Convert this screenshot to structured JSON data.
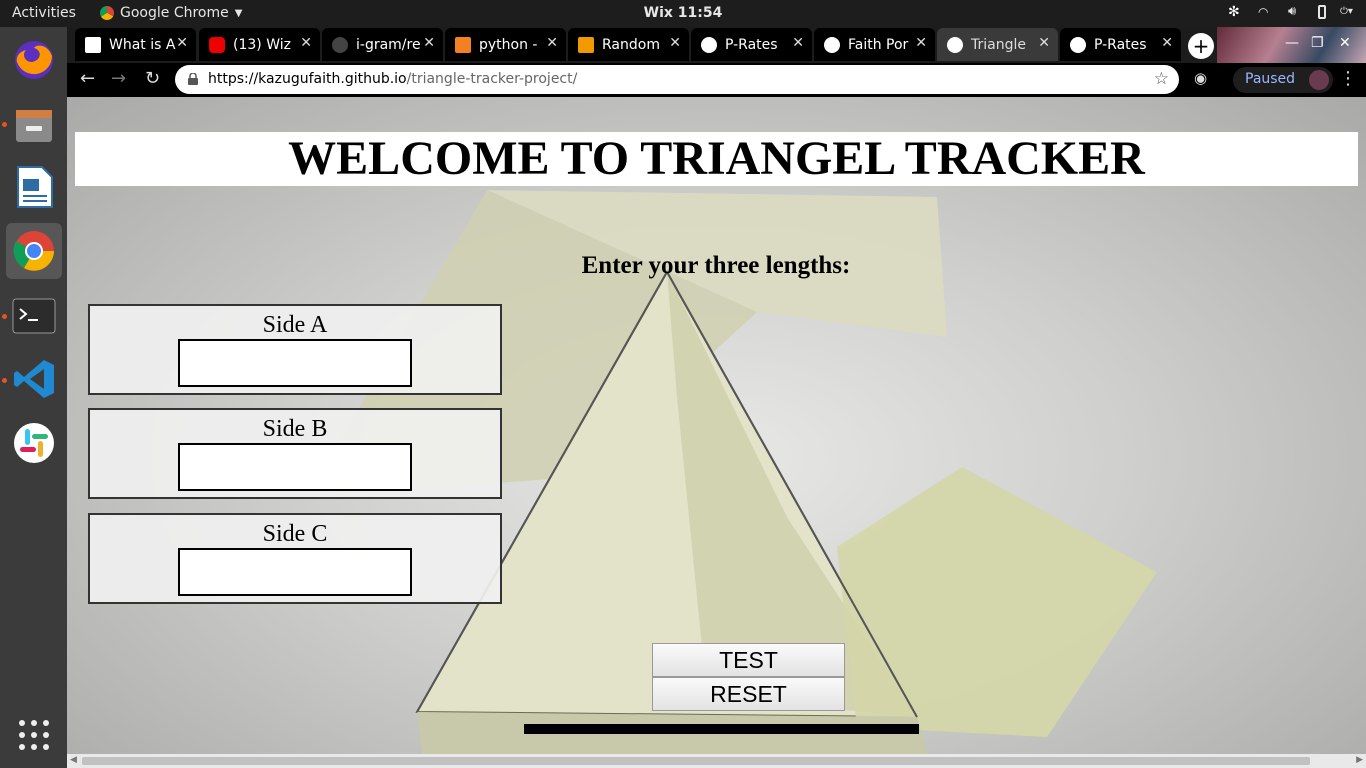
{
  "system_bar": {
    "activities": "Activities",
    "app_name": "Google Chrome",
    "clock": "Wix 11:54"
  },
  "dock": {
    "items": [
      "firefox-icon",
      "files-icon",
      "writer-icon",
      "chrome-icon",
      "terminal-icon",
      "vscode-icon",
      "slack-icon",
      "app-grid-icon"
    ]
  },
  "browser": {
    "tabs": [
      {
        "label": "What is A"
      },
      {
        "label": "(13) Wiz"
      },
      {
        "label": "i-gram/re"
      },
      {
        "label": "python -"
      },
      {
        "label": "Random"
      },
      {
        "label": "P-Rates"
      },
      {
        "label": "Faith Por"
      },
      {
        "label": "Triangle"
      },
      {
        "label": "P-Rates"
      }
    ],
    "url_host": "https://kazugufaith.github.io",
    "url_path": "/triangle-tracker-project/",
    "profile_status": "Paused",
    "colors": {
      "frame": "#000000",
      "active_tab": "#3a3a3a",
      "paused_text": "#9ab6ff"
    }
  },
  "page": {
    "title": "WELCOME TO TRIANGEL TRACKER",
    "prompt": "Enter your three lengths:",
    "fields": [
      {
        "label": "Side A",
        "value": ""
      },
      {
        "label": "Side B",
        "value": ""
      },
      {
        "label": "Side C",
        "value": ""
      }
    ],
    "test_button": "TEST",
    "reset_button": "RESET"
  }
}
